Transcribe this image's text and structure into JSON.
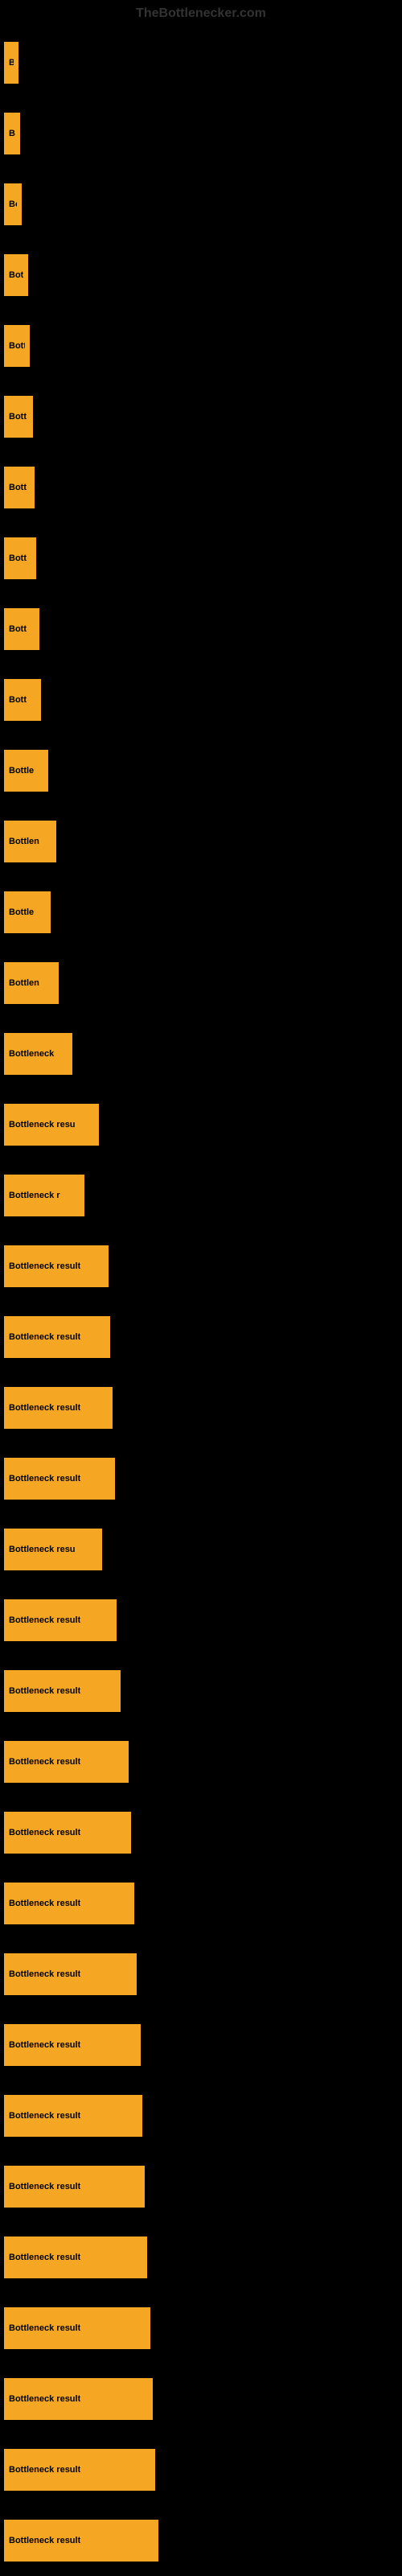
{
  "site": {
    "title": "TheBottlenecker.com"
  },
  "bars": [
    {
      "id": 1,
      "label": "Bo",
      "width": 18
    },
    {
      "id": 2,
      "label": "Bo",
      "width": 20
    },
    {
      "id": 3,
      "label": "Bo",
      "width": 22
    },
    {
      "id": 4,
      "label": "Bott",
      "width": 30
    },
    {
      "id": 5,
      "label": "Bott",
      "width": 32
    },
    {
      "id": 6,
      "label": "Bott",
      "width": 36
    },
    {
      "id": 7,
      "label": "Bott",
      "width": 38
    },
    {
      "id": 8,
      "label": "Bott",
      "width": 40
    },
    {
      "id": 9,
      "label": "Bott",
      "width": 44
    },
    {
      "id": 10,
      "label": "Bott",
      "width": 46
    },
    {
      "id": 11,
      "label": "Bottle",
      "width": 55
    },
    {
      "id": 12,
      "label": "Bottlen",
      "width": 65
    },
    {
      "id": 13,
      "label": "Bottle",
      "width": 58
    },
    {
      "id": 14,
      "label": "Bottlen",
      "width": 68
    },
    {
      "id": 15,
      "label": "Bottleneck",
      "width": 85
    },
    {
      "id": 16,
      "label": "Bottleneck resu",
      "width": 118
    },
    {
      "id": 17,
      "label": "Bottleneck r",
      "width": 100
    },
    {
      "id": 18,
      "label": "Bottleneck result",
      "width": 130
    },
    {
      "id": 19,
      "label": "Bottleneck result",
      "width": 132
    },
    {
      "id": 20,
      "label": "Bottleneck result",
      "width": 135
    },
    {
      "id": 21,
      "label": "Bottleneck result",
      "width": 138
    },
    {
      "id": 22,
      "label": "Bottleneck resu",
      "width": 122
    },
    {
      "id": 23,
      "label": "Bottleneck result",
      "width": 140
    },
    {
      "id": 24,
      "label": "Bottleneck result",
      "width": 145
    },
    {
      "id": 25,
      "label": "Bottleneck result",
      "width": 155
    },
    {
      "id": 26,
      "label": "Bottleneck result",
      "width": 158
    },
    {
      "id": 27,
      "label": "Bottleneck result",
      "width": 162
    },
    {
      "id": 28,
      "label": "Bottleneck result",
      "width": 165
    },
    {
      "id": 29,
      "label": "Bottleneck result",
      "width": 170
    },
    {
      "id": 30,
      "label": "Bottleneck result",
      "width": 172
    },
    {
      "id": 31,
      "label": "Bottleneck result",
      "width": 175
    },
    {
      "id": 32,
      "label": "Bottleneck result",
      "width": 178
    },
    {
      "id": 33,
      "label": "Bottleneck result",
      "width": 182
    },
    {
      "id": 34,
      "label": "Bottleneck result",
      "width": 185
    },
    {
      "id": 35,
      "label": "Bottleneck result",
      "width": 188
    },
    {
      "id": 36,
      "label": "Bottleneck result",
      "width": 192
    }
  ]
}
